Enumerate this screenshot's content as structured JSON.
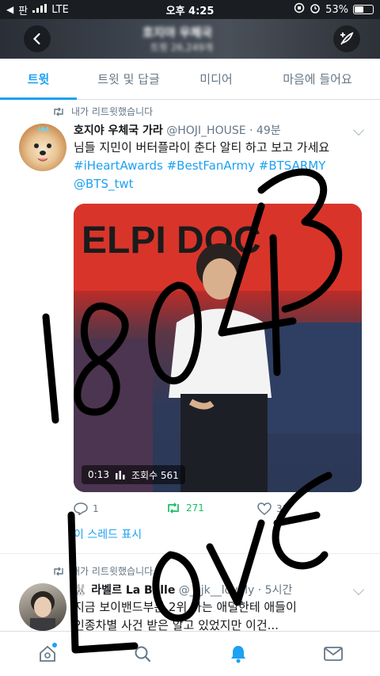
{
  "status_bar": {
    "carrier": "판",
    "network": "LTE",
    "time": "오후 4:25",
    "battery_text": "53%",
    "battery_level": 0.53
  },
  "header": {
    "title": "호지야 우체국",
    "subtitle": "트윗 26,249개"
  },
  "tabs": [
    {
      "label": "트윗",
      "active": true
    },
    {
      "label": "트윗 및 답글",
      "active": false
    },
    {
      "label": "미디어",
      "active": false
    },
    {
      "label": "마음에 들어요",
      "active": false
    }
  ],
  "tweet1": {
    "retweet_label": "내가 리트윗했습니다",
    "author_name": "호지야 우체국 가라",
    "handle_time": "@HOJI_HOUSE · 49분",
    "text_line1": "님들 지민이 버터플라이 춘다 알티 하고 보고 가세요",
    "text_line2": "#iHeartAwards #BestFanArmy #BTSARMY",
    "text_line3": "@BTS_twt",
    "video_duration": "0:13",
    "video_views": "조회수 561",
    "video_sign_text": "ELPI DOC",
    "replies": "1",
    "retweets": "271",
    "likes": "33",
    "thread_link": "이 스레드 표시"
  },
  "tweet2": {
    "retweet_label": "내가 리트윗했습니다",
    "author_name": "🐰 라벨르 La Belle",
    "handle_time": "@__jk__lovely · 5시간",
    "text_line1": "지금 보이밴드부분 2위 하는 애덜한테 애들이",
    "text_line2": "인종차별 사건 받은 알고 있었지만 이건..."
  },
  "handwriting_text": "18043 LOVE",
  "colors": {
    "accent": "#1da1f2",
    "retweet_green": "#17bf63",
    "muted": "#657786"
  },
  "icons": [
    "back-arrow-icon",
    "compose-tweet-icon",
    "retweet-icon",
    "reply-icon",
    "like-icon",
    "home-icon",
    "search-icon",
    "notifications-icon",
    "messages-icon"
  ]
}
